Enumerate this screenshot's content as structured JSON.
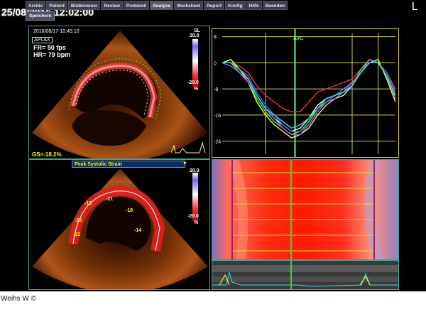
{
  "header": {
    "datetime": "25/08/2016 12:02:00",
    "corner_label": "L",
    "menu": [
      "Archiv",
      "Patient",
      "Bildbrowser",
      "Review",
      "Protokoll",
      "Analyse",
      "Worksheet",
      "Report",
      "Konfig",
      "Hilfe",
      "Beenden"
    ],
    "active_menu": "Analyse",
    "save_label": "Speichern"
  },
  "top_left": {
    "timestamp": "2016/08/17-10:45:10",
    "view": "APLAX",
    "frame_rate": "FR= 50 fps",
    "heart_rate": "HR= 79 bpm",
    "scale_name": "SL",
    "scale_max": "20.0",
    "scale_min": "-20.0",
    "scale_unit": "%",
    "gs": "GS=-18.2%"
  },
  "bottom_left": {
    "mode_label": "Peak Systolic Strain",
    "scale_max": "20.0",
    "scale_min": "-20.0",
    "scale_unit": "%",
    "segment_values": [
      "-18",
      "-21",
      "-18",
      "-14",
      "-23",
      "-22"
    ]
  },
  "strain_chart": {
    "event_label": "AVC",
    "y_ticks": [
      "8",
      "0",
      "-8",
      "-16",
      "-24"
    ]
  },
  "credit": "Weihs W ©",
  "colors": {
    "accent_border": "#33aa99",
    "avc_marker": "#66ff66",
    "gs_text": "#ffff00"
  },
  "chart_data": {
    "type": "line",
    "title": "",
    "xlabel": "",
    "ylabel": "",
    "ylim": [
      -28,
      9
    ],
    "x": [
      0,
      0.05,
      0.1,
      0.15,
      0.2,
      0.25,
      0.3,
      0.35,
      0.4,
      0.45,
      0.5,
      0.55,
      0.6,
      0.65,
      0.7,
      0.75,
      0.8,
      0.85,
      0.9,
      0.95,
      1.0
    ],
    "event_x": 0.42,
    "series": [
      {
        "color": "#ff3030",
        "values": [
          0,
          0,
          -1,
          -3,
          -7,
          -10,
          -12,
          -14,
          -15,
          -15,
          -12,
          -9,
          -8,
          -7,
          -6,
          -5,
          -2,
          1,
          0,
          -3,
          -8
        ]
      },
      {
        "color": "#ffffff",
        "values": [
          0,
          0,
          -2,
          -5,
          -10,
          -14,
          -17,
          -19,
          -21,
          -20,
          -17,
          -13,
          -11,
          -10,
          -8,
          -6,
          -3,
          1,
          0,
          -4,
          -10
        ]
      },
      {
        "color": "#ffff30",
        "values": [
          0,
          1,
          -2,
          -6,
          -12,
          -16,
          -19,
          -21,
          -23,
          -22,
          -20,
          -16,
          -13,
          -11,
          -10,
          -7,
          -3,
          0,
          1,
          -5,
          -12
        ]
      },
      {
        "color": "#30ff30",
        "values": [
          0,
          0,
          -3,
          -6,
          -11,
          -15,
          -18,
          -20,
          -22,
          -21,
          -18,
          -14,
          -12,
          -10,
          -9,
          -7,
          -2,
          1,
          0,
          -4,
          -11
        ]
      },
      {
        "color": "#4060ff",
        "values": [
          0,
          0,
          -2,
          -4,
          -9,
          -13,
          -16,
          -19,
          -21,
          -21,
          -19,
          -15,
          -12,
          -10,
          -8,
          -6,
          -3,
          0,
          0,
          -3,
          -9
        ]
      },
      {
        "color": "#c050ff",
        "values": [
          0,
          -1,
          -3,
          -6,
          -10,
          -14,
          -17,
          -20,
          -22,
          -22,
          -19,
          -15,
          -12,
          -11,
          -9,
          -6,
          -3,
          1,
          0,
          -4,
          -11
        ]
      },
      {
        "color": "#30e0e0",
        "values": [
          0,
          0,
          -2,
          -5,
          -10,
          -14,
          -16,
          -18,
          -20,
          -19,
          -17,
          -14,
          -11,
          -10,
          -9,
          -7,
          -3,
          0,
          0,
          -4,
          -10
        ]
      }
    ]
  }
}
